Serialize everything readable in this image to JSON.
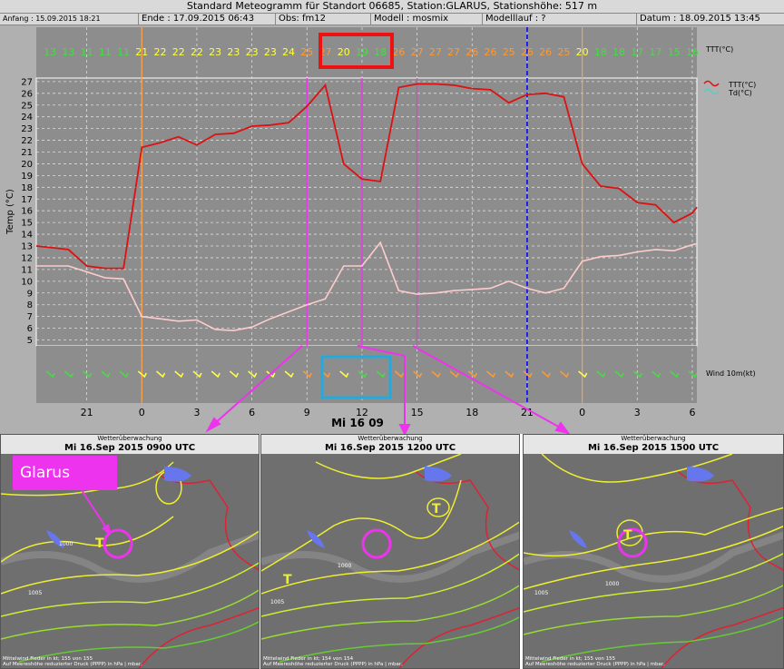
{
  "header": {
    "title": "Standard Meteogramm für Standort 06685, Station:GLARUS, Stationshöhe: 517 m",
    "anfang": "Anfang : 15.09.2015 18:21",
    "ende": "Ende : 17.09.2015 06:43",
    "obs": "Obs: fm12",
    "modell": "Modell : mosmix",
    "modelllauf": "Modelllauf : ?",
    "datum": "Datum : 18.09.2015 13:45"
  },
  "colors": {
    "ttt": "#dd1111",
    "td": "#ffcccc",
    "highlight_red": "#ee1111",
    "highlight_blue": "#22aadd",
    "arrow": "#ee33ee",
    "midnight": "#ffa040",
    "now": "#0000ee"
  },
  "chart_data": {
    "type": "line",
    "ylabel": "Temp (°C)",
    "ylim": [
      4.5,
      27.3
    ],
    "yticks": [
      5,
      6,
      7,
      8,
      9,
      10,
      11,
      12,
      13,
      14,
      15,
      16,
      17,
      18,
      19,
      20,
      21,
      22,
      23,
      24,
      25,
      26,
      27
    ],
    "x_range": [
      -5.75,
      30.25
    ],
    "x_ticks": [
      {
        "x": -3,
        "label": "21"
      },
      {
        "x": 0,
        "label": "0"
      },
      {
        "x": 3,
        "label": "3"
      },
      {
        "x": 6,
        "label": "6"
      },
      {
        "x": 9,
        "label": "9"
      },
      {
        "x": 12,
        "label": "12"
      },
      {
        "x": 15,
        "label": "15"
      },
      {
        "x": 18,
        "label": "18"
      },
      {
        "x": 21,
        "label": "21"
      },
      {
        "x": 24,
        "label": "0"
      },
      {
        "x": 27,
        "label": "3"
      },
      {
        "x": 30,
        "label": "6"
      }
    ],
    "date_label": "Mi 16 09",
    "midnight_lines": [
      0,
      24
    ],
    "now_line": 21,
    "series": [
      {
        "name": "TTT(°C)",
        "x": [
          -5.75,
          -4,
          -3,
          -2,
          -1,
          0,
          1,
          2,
          3,
          4,
          5,
          6,
          7,
          8,
          9,
          10,
          11,
          12,
          13,
          14,
          15,
          16,
          17,
          18,
          19,
          20,
          21,
          22,
          23,
          24,
          25,
          26,
          27,
          28,
          29,
          30,
          30.25
        ],
        "values": [
          13.0,
          12.7,
          11.3,
          11.1,
          11.1,
          21.4,
          21.8,
          22.3,
          21.6,
          22.5,
          22.6,
          23.2,
          23.3,
          23.5,
          24.9,
          26.7,
          20.0,
          18.7,
          18.5,
          26.5,
          26.8,
          26.8,
          26.7,
          26.4,
          26.3,
          25.2,
          25.9,
          26.0,
          25.7,
          20.0,
          18.1,
          17.9,
          16.7,
          16.5,
          15.0,
          15.8,
          16.3
        ]
      },
      {
        "name": "Td(°C)",
        "x": [
          -5.75,
          -4,
          -3,
          -2,
          -1,
          0,
          1,
          2,
          3,
          4,
          5,
          6,
          7,
          8,
          9,
          10,
          11,
          12,
          13,
          14,
          15,
          16,
          17,
          18,
          19,
          20,
          21,
          22,
          23,
          24,
          25,
          26,
          27,
          28,
          29,
          30,
          30.25
        ],
        "values": [
          11.3,
          11.3,
          10.8,
          10.3,
          10.2,
          7.0,
          6.8,
          6.6,
          6.7,
          5.9,
          5.8,
          6.1,
          6.8,
          7.4,
          8.0,
          8.5,
          11.3,
          11.3,
          13.3,
          9.2,
          8.9,
          9.0,
          9.2,
          9.3,
          9.4,
          10.0,
          9.4,
          9.0,
          9.4,
          11.7,
          12.1,
          12.2,
          12.5,
          12.7,
          12.6,
          13.1,
          13.2
        ]
      }
    ],
    "ttt_row": {
      "label": "TTT(°C)",
      "x": [
        -5,
        -4,
        -3,
        -2,
        -1,
        0,
        1,
        2,
        3,
        4,
        5,
        6,
        7,
        8,
        9,
        10,
        11,
        12,
        13,
        14,
        15,
        16,
        17,
        18,
        19,
        20,
        21,
        22,
        23,
        24,
        25,
        26,
        27,
        28,
        29,
        30
      ],
      "values": [
        "13",
        "13",
        "11",
        "11",
        "11",
        "21",
        "22",
        "22",
        "22",
        "23",
        "23",
        "23",
        "23",
        "24",
        "25",
        "27",
        "20",
        "19",
        "18",
        "26",
        "27",
        "27",
        "27",
        "26",
        "26",
        "25",
        "26",
        "26",
        "25",
        "20",
        "18",
        "18",
        "17",
        "17",
        "15",
        "16"
      ]
    },
    "legend": [
      "TTT(°C)",
      "Td(°C)"
    ],
    "wind_label": "Wind 10m(kt)"
  },
  "maps": [
    {
      "head": "Wetterüberwachung",
      "time": "Mi 16.Sep 2015 0900 UTC",
      "foot1": "Mittelwind Fieder in kt; 155 von 155",
      "foot2": "Auf Meereshöhe reduzierter Druck (PPPP) in hPa | mbar,"
    },
    {
      "head": "Wetterüberwachung",
      "time": "Mi 16.Sep 2015 1200 UTC",
      "foot1": "Mittelwind Fieder in kt; 154 von 154",
      "foot2": "Auf Meereshöhe reduzierter Druck (PPPP) in hPa | mbar,"
    },
    {
      "head": "Wetterüberwachung",
      "time": "Mi 16.Sep 2015 1500 UTC",
      "foot1": "Mittelwind Fieder in kt; 155 von 155",
      "foot2": "Auf Meereshöhe reduzierter Druck (PPPP) in hPa | mbar,"
    }
  ],
  "glarus_label": "Glarus",
  "map_symbol": "T",
  "map_isobar_labels": [
    "1000",
    "1005"
  ]
}
